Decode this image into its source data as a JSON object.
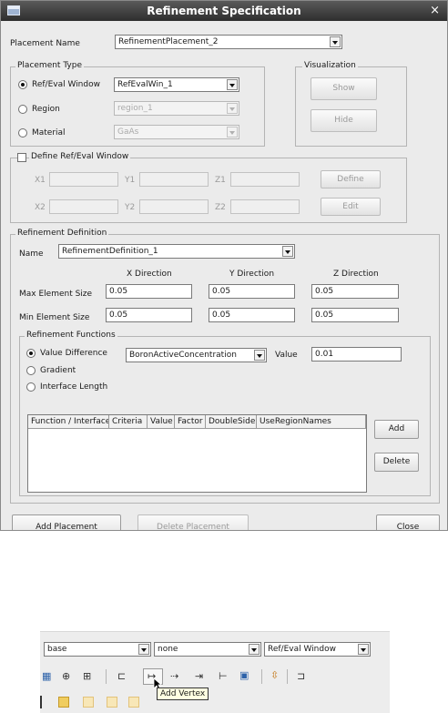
{
  "dialog": {
    "title": "Refinement Specification",
    "close_glyph": "×",
    "placement_name_label": "Placement Name",
    "placement_name_value": "RefinementPlacement_2",
    "placement_type": {
      "group_label": "Placement Type",
      "ref_eval_label": "Ref/Eval Window",
      "ref_eval_value": "RefEvalWin_1",
      "region_label": "Region",
      "region_value": "region_1",
      "material_label": "Material",
      "material_value": "GaAs"
    },
    "visualization": {
      "group_label": "Visualization",
      "show": "Show",
      "hide": "Hide"
    },
    "define_window": {
      "group_label": "Define Ref/Eval Window",
      "x1": "X1",
      "y1": "Y1",
      "z1": "Z1",
      "x2": "X2",
      "y2": "Y2",
      "z2": "Z2",
      "define": "Define",
      "edit": "Edit"
    },
    "refinement_definition": {
      "group_label": "Refinement Definition",
      "name_label": "Name",
      "name_value": "RefinementDefinition_1",
      "x_dir": "X Direction",
      "y_dir": "Y Direction",
      "z_dir": "Z Direction",
      "max_label": "Max Element Size",
      "max_values": [
        "0.05",
        "0.05",
        "0.05"
      ],
      "min_label": "Min Element Size",
      "min_values": [
        "0.05",
        "0.05",
        "0.05"
      ]
    },
    "refinement_functions": {
      "group_label": "Refinement Functions",
      "value_difference": "Value Difference",
      "gradient": "Gradient",
      "interface_length": "Interface Length",
      "quantity_value": "BoronActiveConcentration",
      "value_label": "Value",
      "value_input": "0.01",
      "columns": [
        "Function / Interface",
        "Criteria",
        "Value",
        "Factor",
        "DoubleSide",
        "UseRegionNames"
      ],
      "add": "Add",
      "delete": "Delete"
    },
    "footer": {
      "add_placement": "Add Placement",
      "delete_placement": "Delete Placement",
      "close": "Close"
    }
  },
  "toolbar": {
    "combo1": "base",
    "combo2": "none",
    "combo3": "Ref/Eval Window",
    "tooltip": "Add Vertex",
    "icons": [
      "grid-icon",
      "globe-icon",
      "ruler-icon",
      "add-vertex-icon",
      "move-vertex-icon",
      "move-edge-icon",
      "split-icon",
      "image-icon",
      "stretch-icon",
      "mirror-icon",
      "layer-icon"
    ]
  }
}
